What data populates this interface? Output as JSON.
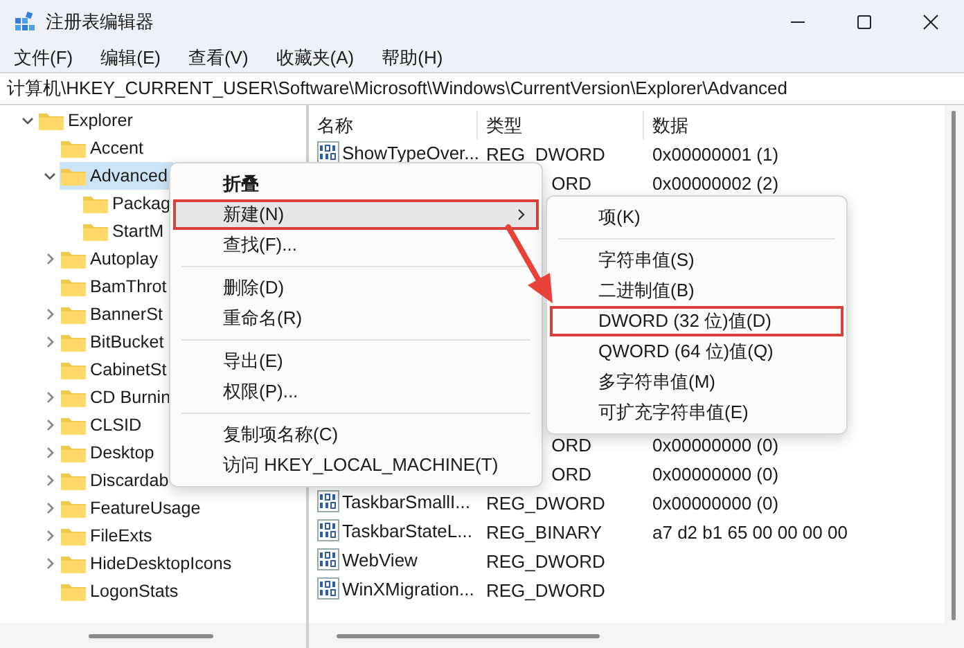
{
  "window": {
    "title": "注册表编辑器"
  },
  "menu_bar": [
    "文件(F)",
    "编辑(E)",
    "查看(V)",
    "收藏夹(A)",
    "帮助(H)"
  ],
  "address": "计算机\\HKEY_CURRENT_USER\\Software\\Microsoft\\Windows\\CurrentVersion\\Explorer\\Advanced",
  "tree": {
    "items": [
      {
        "label": "Explorer",
        "expandable": true,
        "expanded": true,
        "selected": false,
        "children": [
          {
            "label": "Accent",
            "expandable": false,
            "selected": false
          },
          {
            "label": "Advanced",
            "expandable": true,
            "expanded": true,
            "selected": true,
            "children": [
              {
                "label": "Packag",
                "expandable": false,
                "selected": false
              },
              {
                "label": "StartM",
                "expandable": false,
                "selected": false
              }
            ]
          },
          {
            "label": "Autoplay",
            "expandable": true,
            "expanded": false,
            "selected": false
          },
          {
            "label": "BamThrot",
            "expandable": false,
            "selected": false
          },
          {
            "label": "BannerSt",
            "expandable": true,
            "expanded": false,
            "selected": false
          },
          {
            "label": "BitBucket",
            "expandable": true,
            "expanded": false,
            "selected": false
          },
          {
            "label": "CabinetSt",
            "expandable": false,
            "selected": false
          },
          {
            "label": "CD Burnin",
            "expandable": true,
            "expanded": false,
            "selected": false
          },
          {
            "label": "CLSID",
            "expandable": true,
            "expanded": false,
            "selected": false
          },
          {
            "label": "Desktop",
            "expandable": true,
            "expanded": false,
            "selected": false
          },
          {
            "label": "Discardab",
            "expandable": true,
            "expanded": false,
            "selected": false
          },
          {
            "label": "FeatureUsage",
            "expandable": true,
            "expanded": false,
            "selected": false
          },
          {
            "label": "FileExts",
            "expandable": true,
            "expanded": false,
            "selected": false
          },
          {
            "label": "HideDesktopIcons",
            "expandable": true,
            "expanded": false,
            "selected": false
          },
          {
            "label": "LogonStats",
            "expandable": false,
            "selected": false
          }
        ]
      }
    ]
  },
  "values": {
    "columns": [
      "名称",
      "类型",
      "数据"
    ],
    "row_groups": [
      {
        "rows": [
          {
            "name": "ShowTypeOver...",
            "type": "REG_DWORD",
            "type_clipped": false,
            "data": "0x00000001 (1)"
          },
          {
            "type": "ORD",
            "type_clipped": true,
            "data": "0x00000002 (2)"
          }
        ]
      },
      {
        "rows": [
          {
            "type": "ORD",
            "type_clipped": true,
            "data": "0x00000000 (0)"
          },
          {
            "type": "ORD",
            "type_clipped": true,
            "data": "0x00000000 (0)"
          },
          {
            "name": "TaskbarSmallI...",
            "type": "REG_DWORD",
            "type_clipped": false,
            "data": "0x00000000 (0)"
          },
          {
            "name": "TaskbarStateL...",
            "type": "REG_BINARY",
            "type_clipped": false,
            "data": "a7 d2 b1 65 00 00 00 00"
          },
          {
            "name": "WebView",
            "type": "REG_DWORD",
            "type_clipped": false
          },
          {
            "name": "WinXMigration...",
            "type": "REG_DWORD",
            "type_clipped": false
          }
        ]
      }
    ]
  },
  "context_menu": {
    "items": [
      {
        "kind": "item",
        "label": "折叠",
        "bold": true,
        "submenu": false,
        "highlighted": false,
        "outlined": false
      },
      {
        "kind": "item",
        "label": "新建(N)",
        "bold": false,
        "submenu": true,
        "highlighted": true,
        "outlined": true
      },
      {
        "kind": "item",
        "label": "查找(F)...",
        "bold": false,
        "submenu": false,
        "highlighted": false,
        "outlined": false
      },
      {
        "kind": "separator"
      },
      {
        "kind": "item",
        "label": "删除(D)",
        "bold": false,
        "submenu": false,
        "highlighted": false,
        "outlined": false
      },
      {
        "kind": "item",
        "label": "重命名(R)",
        "bold": false,
        "submenu": false,
        "highlighted": false,
        "outlined": false
      },
      {
        "kind": "separator"
      },
      {
        "kind": "item",
        "label": "导出(E)",
        "bold": false,
        "submenu": false,
        "highlighted": false,
        "outlined": false
      },
      {
        "kind": "item",
        "label": "权限(P)...",
        "bold": false,
        "submenu": false,
        "highlighted": false,
        "outlined": false
      },
      {
        "kind": "separator"
      },
      {
        "kind": "item",
        "label": "复制项名称(C)",
        "bold": false,
        "submenu": false,
        "highlighted": false,
        "outlined": false
      },
      {
        "kind": "item",
        "label": "访问 HKEY_LOCAL_MACHINE(T)",
        "bold": false,
        "submenu": false,
        "highlighted": false,
        "outlined": false
      }
    ]
  },
  "submenu": {
    "items": [
      {
        "kind": "item",
        "label": "项(K)",
        "bold": false,
        "submenu": false,
        "highlighted": false,
        "outlined": false
      },
      {
        "kind": "separator"
      },
      {
        "kind": "item",
        "label": "字符串值(S)",
        "bold": false,
        "submenu": false,
        "highlighted": false,
        "outlined": false
      },
      {
        "kind": "item",
        "label": "二进制值(B)",
        "bold": false,
        "submenu": false,
        "highlighted": false,
        "outlined": false
      },
      {
        "kind": "item",
        "label": "DWORD (32 位)值(D)",
        "bold": false,
        "submenu": false,
        "highlighted": false,
        "outlined": true
      },
      {
        "kind": "item",
        "label": "QWORD (64 位)值(Q)",
        "bold": false,
        "submenu": false,
        "highlighted": false,
        "outlined": false
      },
      {
        "kind": "item",
        "label": "多字符串值(M)",
        "bold": false,
        "submenu": false,
        "highlighted": false,
        "outlined": false
      },
      {
        "kind": "item",
        "label": "可扩充字符串值(E)",
        "bold": false,
        "submenu": false,
        "highlighted": false,
        "outlined": false
      }
    ]
  }
}
